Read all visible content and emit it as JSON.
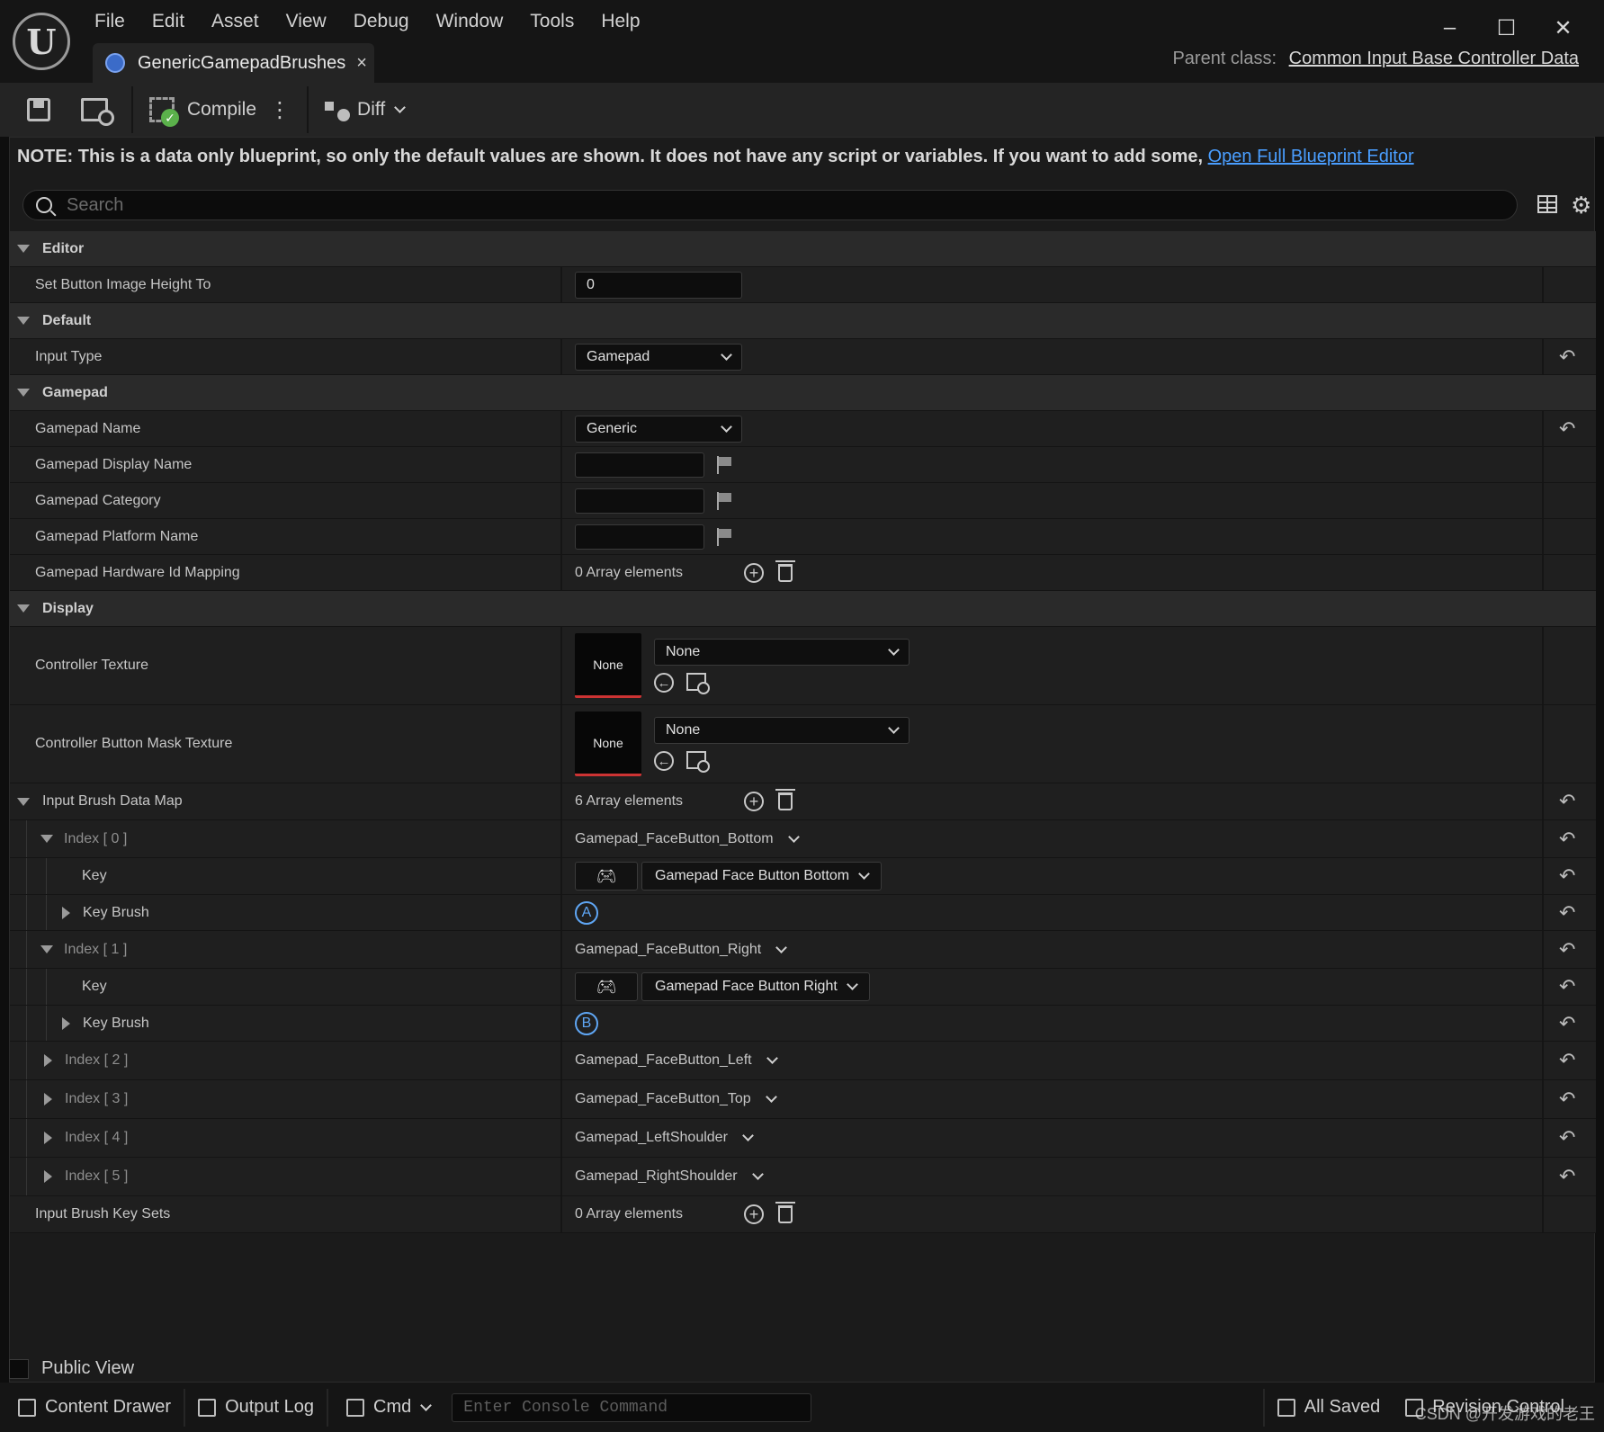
{
  "menu": [
    "File",
    "Edit",
    "Asset",
    "View",
    "Debug",
    "Window",
    "Tools",
    "Help"
  ],
  "tab": {
    "label": "GenericGamepadBrushes",
    "close": "×"
  },
  "parent_class": {
    "label": "Parent class:",
    "value": "Common Input Base Controller Data"
  },
  "toolbar": {
    "compile": "Compile",
    "diff": "Diff"
  },
  "note": {
    "text": "NOTE: This is a data only blueprint, so only the default values are shown.  It does not have any script or variables.  If you want to add some,",
    "link": "Open Full Blueprint Editor"
  },
  "search": {
    "placeholder": "Search"
  },
  "categories": {
    "editor": "Editor",
    "default": "Default",
    "gamepad": "Gamepad",
    "display": "Display"
  },
  "props": {
    "set_button_image_height": {
      "label": "Set Button Image Height To",
      "value": "0"
    },
    "input_type": {
      "label": "Input Type",
      "value": "Gamepad"
    },
    "gamepad_name": {
      "label": "Gamepad Name",
      "value": "Generic"
    },
    "gamepad_display_name": {
      "label": "Gamepad Display Name"
    },
    "gamepad_category": {
      "label": "Gamepad Category"
    },
    "gamepad_platform_name": {
      "label": "Gamepad Platform Name"
    },
    "gamepad_hardware_id_mapping": {
      "label": "Gamepad Hardware Id Mapping",
      "value": "0 Array elements"
    },
    "controller_texture": {
      "label": "Controller Texture",
      "thumb": "None",
      "value": "None"
    },
    "controller_button_mask_texture": {
      "label": "Controller Button Mask Texture",
      "thumb": "None",
      "value": "None"
    },
    "input_brush_data_map": {
      "label": "Input Brush Data Map",
      "value": "6 Array elements"
    },
    "input_brush_key_sets": {
      "label": "Input Brush Key Sets",
      "value": "0 Array elements"
    }
  },
  "brush_map": [
    {
      "index": "Index [ 0 ]",
      "value": "Gamepad_FaceButton_Bottom",
      "expanded": true,
      "key_label": "Key",
      "key_value": "Gamepad Face Button Bottom",
      "brush_label": "Key Brush",
      "brush_glyph": "A"
    },
    {
      "index": "Index [ 1 ]",
      "value": "Gamepad_FaceButton_Right",
      "expanded": true,
      "key_label": "Key",
      "key_value": "Gamepad Face Button Right",
      "brush_label": "Key Brush",
      "brush_glyph": "B"
    },
    {
      "index": "Index [ 2 ]",
      "value": "Gamepad_FaceButton_Left",
      "expanded": false
    },
    {
      "index": "Index [ 3 ]",
      "value": "Gamepad_FaceButton_Top",
      "expanded": false
    },
    {
      "index": "Index [ 4 ]",
      "value": "Gamepad_LeftShoulder",
      "expanded": false
    },
    {
      "index": "Index [ 5 ]",
      "value": "Gamepad_RightShoulder",
      "expanded": false
    }
  ],
  "public_view": "Public View",
  "statusbar": {
    "content_drawer": "Content Drawer",
    "output_log": "Output Log",
    "cmd": "Cmd",
    "console_placeholder": "Enter Console Command",
    "all_saved": "All Saved",
    "revision_control": "Revision Control"
  },
  "watermark": "CSDN @开发游戏的老王",
  "colors": {
    "accent_link": "#4a9eff",
    "brush_glyph": "#5fa6f4",
    "thumb_underline": "#cc3333",
    "compile_ok": "#5bb14b"
  }
}
